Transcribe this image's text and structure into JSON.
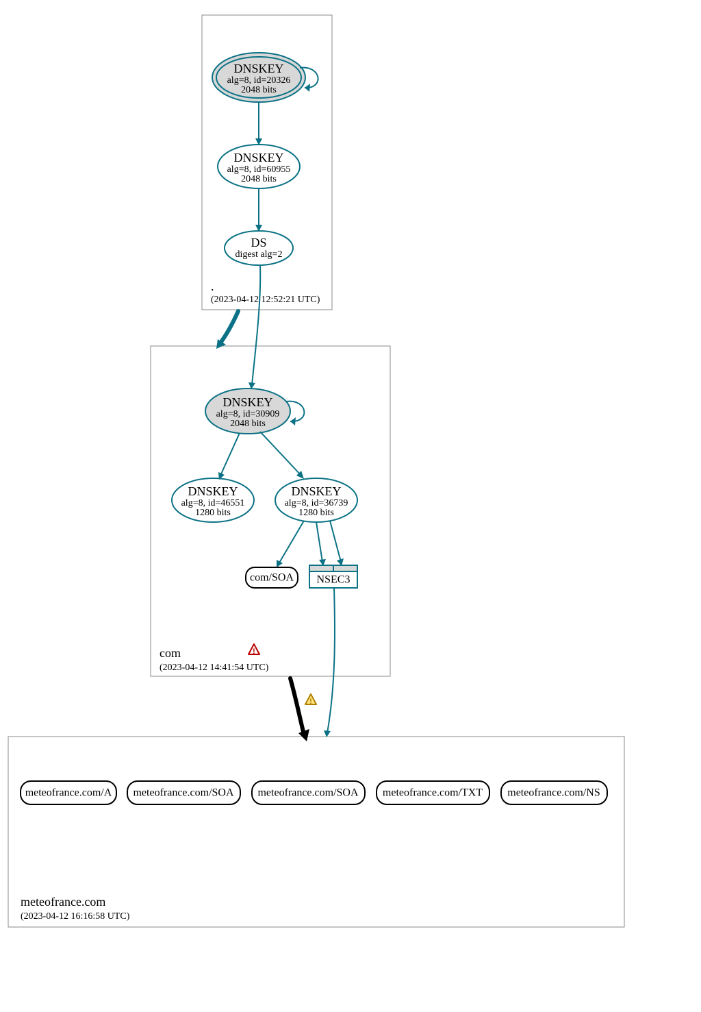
{
  "zones": {
    "root": {
      "label": ".",
      "timestamp": "(2023-04-12 12:52:21 UTC)",
      "dnskey_main": {
        "title": "DNSKEY",
        "line2": "alg=8, id=20326",
        "line3": "2048 bits"
      },
      "dnskey_sub": {
        "title": "DNSKEY",
        "line2": "alg=8, id=60955",
        "line3": "2048 bits"
      },
      "ds": {
        "title": "DS",
        "line2": "digest alg=2"
      }
    },
    "com": {
      "label": "com",
      "timestamp": "(2023-04-12 14:41:54 UTC)",
      "dnskey_main": {
        "title": "DNSKEY",
        "line2": "alg=8, id=30909",
        "line3": "2048 bits"
      },
      "dnskey_left": {
        "title": "DNSKEY",
        "line2": "alg=8, id=46551",
        "line3": "1280 bits"
      },
      "dnskey_right": {
        "title": "DNSKEY",
        "line2": "alg=8, id=36739",
        "line3": "1280 bits"
      },
      "soa": {
        "label": "com/SOA"
      },
      "nsec": {
        "label": "NSEC3"
      }
    },
    "target": {
      "label": "meteofrance.com",
      "timestamp": "(2023-04-12 16:16:58 UTC)",
      "rrsets": [
        "meteofrance.com/A",
        "meteofrance.com/SOA",
        "meteofrance.com/SOA",
        "meteofrance.com/TXT",
        "meteofrance.com/NS"
      ]
    }
  }
}
